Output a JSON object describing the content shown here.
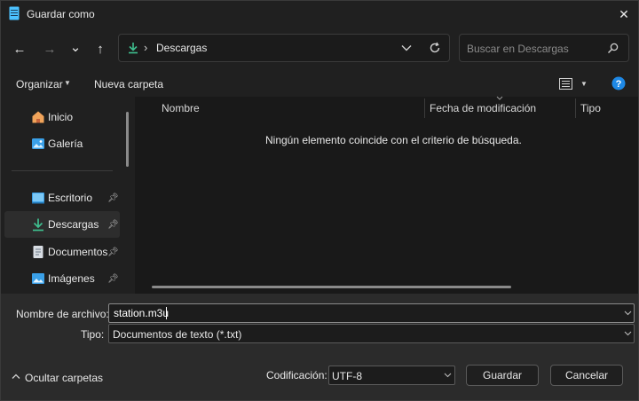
{
  "window": {
    "title": "Guardar como",
    "close_glyph": "✕"
  },
  "nav": {
    "back": "←",
    "forward": "→",
    "recent": "⌄",
    "up": "↑"
  },
  "address": {
    "separator": "›",
    "folder": "Descargas"
  },
  "search": {
    "placeholder": "Buscar en Descargas"
  },
  "toolbar": {
    "organize_label": "Organizar",
    "new_folder_label": "Nueva carpeta"
  },
  "sidebar": {
    "items": [
      {
        "label": "Inicio",
        "icon": "home-icon"
      },
      {
        "label": "Galería",
        "icon": "gallery-icon"
      },
      {
        "label": "Escritorio",
        "icon": "desktop-icon",
        "pinned": true
      },
      {
        "label": "Descargas",
        "icon": "download-icon",
        "pinned": true,
        "selected": true
      },
      {
        "label": "Documentos",
        "icon": "documents-icon",
        "pinned": true
      },
      {
        "label": "Imágenes",
        "icon": "pictures-icon",
        "pinned": true
      }
    ]
  },
  "file_list": {
    "columns": [
      "Nombre",
      "Fecha de modificación",
      "Tipo"
    ],
    "empty_message": "Ningún elemento coincide con el criterio de búsqueda."
  },
  "form": {
    "filename_label": "Nombre de archivo:",
    "filename_value": "station.m3u",
    "type_label": "Tipo:",
    "type_value": "Documentos de texto (*.txt)",
    "encoding_label": "Codificación:",
    "encoding_value": "UTF-8"
  },
  "footer": {
    "hide_folders_label": "Ocultar carpetas",
    "save_label": "Guardar",
    "cancel_label": "Cancelar"
  },
  "colors": {
    "accent": "#4cc2ff",
    "download_green": "#3fbf8f",
    "help_blue": "#1e88e5"
  }
}
